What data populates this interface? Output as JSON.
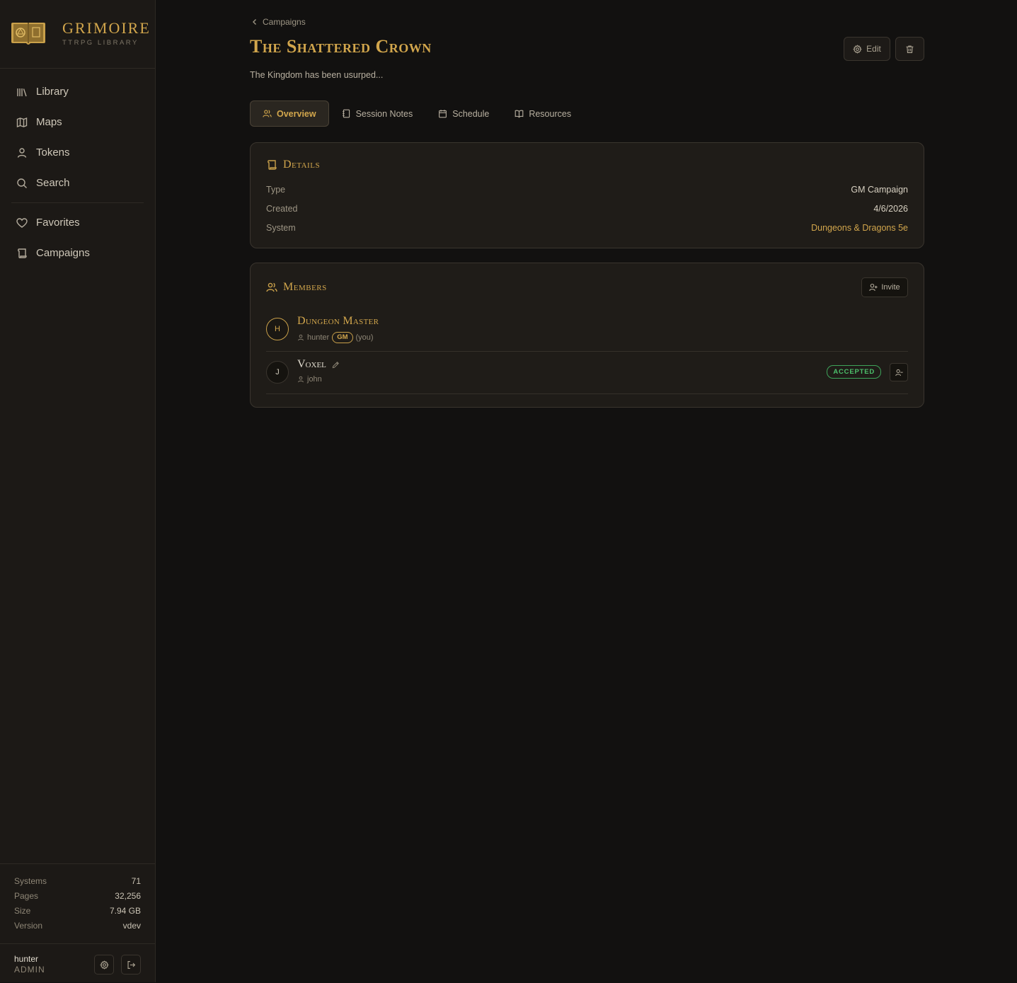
{
  "brand": {
    "title": "GRIMOIRE",
    "subtitle": "TTRPG LIBRARY"
  },
  "nav": {
    "primary": [
      {
        "label": "Library",
        "icon": "library-icon"
      },
      {
        "label": "Maps",
        "icon": "map-icon"
      },
      {
        "label": "Tokens",
        "icon": "user-icon"
      },
      {
        "label": "Search",
        "icon": "search-icon"
      }
    ],
    "secondary": [
      {
        "label": "Favorites",
        "icon": "heart-icon"
      },
      {
        "label": "Campaigns",
        "icon": "scroll-icon"
      }
    ]
  },
  "stats": [
    {
      "label": "Systems",
      "value": "71"
    },
    {
      "label": "Pages",
      "value": "32,256"
    },
    {
      "label": "Size",
      "value": "7.94 GB"
    },
    {
      "label": "Version",
      "value": "vdev"
    }
  ],
  "user": {
    "name": "hunter",
    "role": "ADMIN"
  },
  "breadcrumb": {
    "label": "Campaigns"
  },
  "campaign": {
    "title": "The Shattered Crown",
    "description": "The Kingdom has been usurped..."
  },
  "actions": {
    "edit_label": "Edit"
  },
  "tabs": [
    {
      "label": "Overview",
      "icon": "users-icon",
      "active": true
    },
    {
      "label": "Session Notes",
      "icon": "notebook-icon",
      "active": false
    },
    {
      "label": "Schedule",
      "icon": "calendar-icon",
      "active": false
    },
    {
      "label": "Resources",
      "icon": "book-open-icon",
      "active": false
    }
  ],
  "details": {
    "heading": "Details",
    "rows": [
      {
        "label": "Type",
        "value": "GM Campaign"
      },
      {
        "label": "Created",
        "value": "4/6/2026"
      },
      {
        "label": "System",
        "value": "Dungeons & Dragons 5e"
      }
    ]
  },
  "members": {
    "heading": "Members",
    "invite_label": "Invite",
    "list": [
      {
        "initial": "H",
        "name": "Dungeon Master",
        "username": "hunter",
        "badge": "GM",
        "you": "(you)"
      },
      {
        "initial": "J",
        "name": "Voxel",
        "username": "john",
        "status": "ACCEPTED"
      }
    ]
  },
  "colors": {
    "accent": "#d2a64c",
    "background": "#121110",
    "sidebar": "#1c1916",
    "card": "#1f1c18",
    "accepted": "#4cc06b"
  }
}
